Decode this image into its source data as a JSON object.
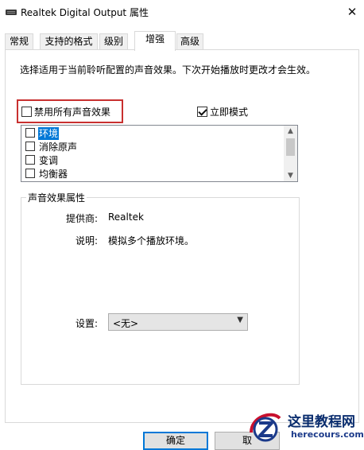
{
  "window": {
    "title": "Realtek Digital Output 属性",
    "close_glyph": "✕"
  },
  "tabs": [
    {
      "label": "常规"
    },
    {
      "label": "支持的格式"
    },
    {
      "label": "级别"
    },
    {
      "label": "增强"
    },
    {
      "label": "高级"
    }
  ],
  "enhancements": {
    "description": "选择适用于当前聆听配置的声音效果。下次开始播放时更改才会生效。",
    "disable_all": {
      "label": "禁用所有声音效果",
      "checked": false
    },
    "immediate_mode": {
      "label": "立即模式",
      "checked": true
    },
    "effects": [
      {
        "label": "环境",
        "checked": false,
        "selected": true
      },
      {
        "label": "消除原声",
        "checked": false
      },
      {
        "label": "变调",
        "checked": false
      },
      {
        "label": "均衡器",
        "checked": false
      }
    ],
    "properties": {
      "group_title": "声音效果属性",
      "provider_label": "提供商:",
      "provider_value": "Realtek",
      "description_label": "说明:",
      "description_value": "模拟多个播放环境。",
      "settings_label": "设置:",
      "settings_value": "<无>"
    }
  },
  "buttons": {
    "ok": "确定",
    "cancel": "取"
  },
  "watermark": {
    "title": "这里教程网",
    "url": "herecours.com"
  }
}
